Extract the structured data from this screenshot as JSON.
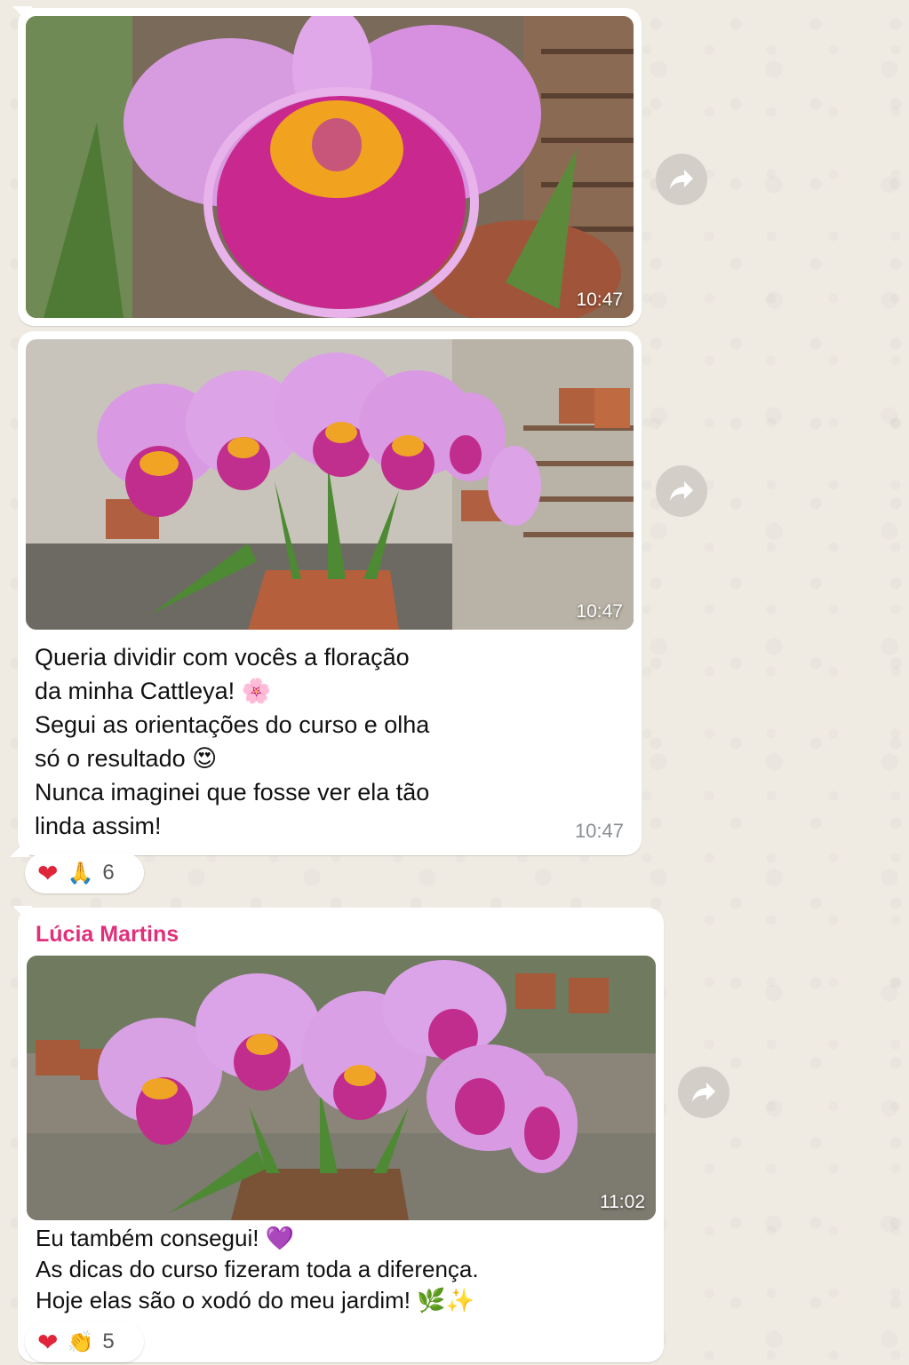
{
  "messages": [
    {
      "type": "image",
      "alt": "Orquídea Cattleya em close",
      "time": "10:47"
    },
    {
      "type": "image-caption",
      "alt": "Vaso de Cattleya com várias flores",
      "time_overlay": "10:47",
      "caption_lines": [
        "Queria dividir com vocês a floração",
        "da minha Cattleya! 🌸",
        "Segui as orientações do curso e olha",
        "só o resultado 😍",
        "Nunca imaginei que fosse ver ela tão",
        "linda assim!"
      ],
      "time": "10:47",
      "reactions": {
        "emojis": [
          "❤",
          "🙏"
        ],
        "count": "6"
      }
    },
    {
      "type": "image-caption",
      "sender": "Lúcia Martins",
      "alt": "Cattleyas floridas em vaso de madeira",
      "time_overlay": "11:02",
      "caption_lines": [
        "Eu também consegui! 💜",
        "As dicas do curso fizeram toda a diferença.",
        "Hoje elas são o xodó do meu jardim! 🌿✨"
      ],
      "reactions": {
        "emojis": [
          "❤",
          "👏"
        ],
        "count": "5"
      }
    }
  ],
  "icons": {
    "forward": "forward-arrow-icon"
  },
  "colors": {
    "sender": "#e0307a",
    "heart": "#e0243a",
    "bubble": "#ffffff",
    "background": "#efeae2"
  }
}
